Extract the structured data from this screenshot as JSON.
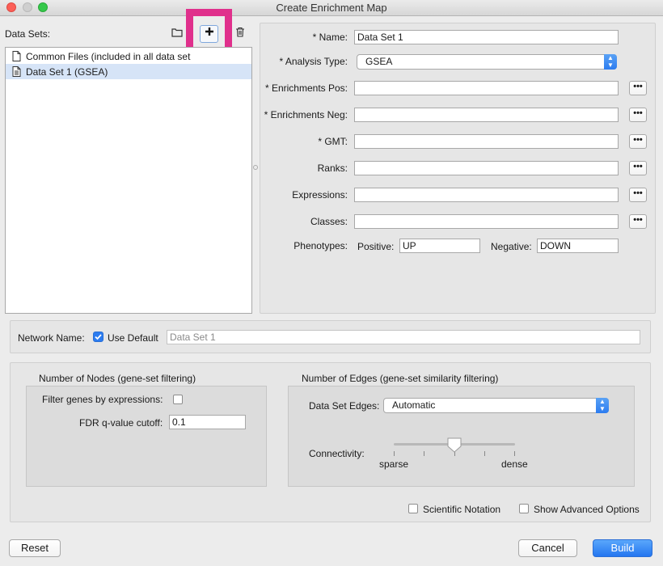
{
  "window": {
    "title": "Create Enrichment Map"
  },
  "data_sets": {
    "label": "Data Sets:",
    "toolbar": {
      "folder_icon": "folder-icon",
      "add_icon": "plus-icon",
      "delete_icon": "trash-icon"
    },
    "items": [
      {
        "label": "Common Files (included in all data set"
      },
      {
        "label": "Data Set 1  (GSEA)"
      }
    ]
  },
  "form": {
    "name_label": "* Name:",
    "name_value": "Data Set 1",
    "analysis_label": "* Analysis Type:",
    "analysis_value": "GSEA",
    "enrich_pos_label": "* Enrichments Pos:",
    "enrich_neg_label": "* Enrichments Neg:",
    "gmt_label": "* GMT:",
    "ranks_label": "Ranks:",
    "expressions_label": "Expressions:",
    "classes_label": "Classes:",
    "browse_label": "•••",
    "phenotypes_label": "Phenotypes:",
    "positive_label": "Positive:",
    "positive_value": "UP",
    "negative_label": "Negative:",
    "negative_value": "DOWN"
  },
  "network": {
    "label": "Network Name:",
    "use_default_label": "Use Default",
    "use_default_checked": true,
    "name_value": "Data Set 1"
  },
  "nodes": {
    "title": "Number of Nodes (gene-set filtering)",
    "filter_label": "Filter genes by expressions:",
    "fdr_label": "FDR q-value cutoff:",
    "fdr_value": "0.1"
  },
  "edges": {
    "title": "Number of Edges (gene-set similarity filtering)",
    "edges_label": "Data Set Edges:",
    "edges_value": "Automatic",
    "connectivity_label": "Connectivity:",
    "sparse_label": "sparse",
    "dense_label": "dense",
    "connectivity_level": 0.5
  },
  "options": {
    "scientific_label": "Scientific Notation",
    "advanced_label": "Show Advanced Options"
  },
  "buttons": {
    "reset": "Reset",
    "cancel": "Cancel",
    "build": "Build"
  },
  "colors": {
    "highlight": "#e0308c",
    "accent": "#2c7cf0",
    "selection": "#d6e4f7"
  }
}
